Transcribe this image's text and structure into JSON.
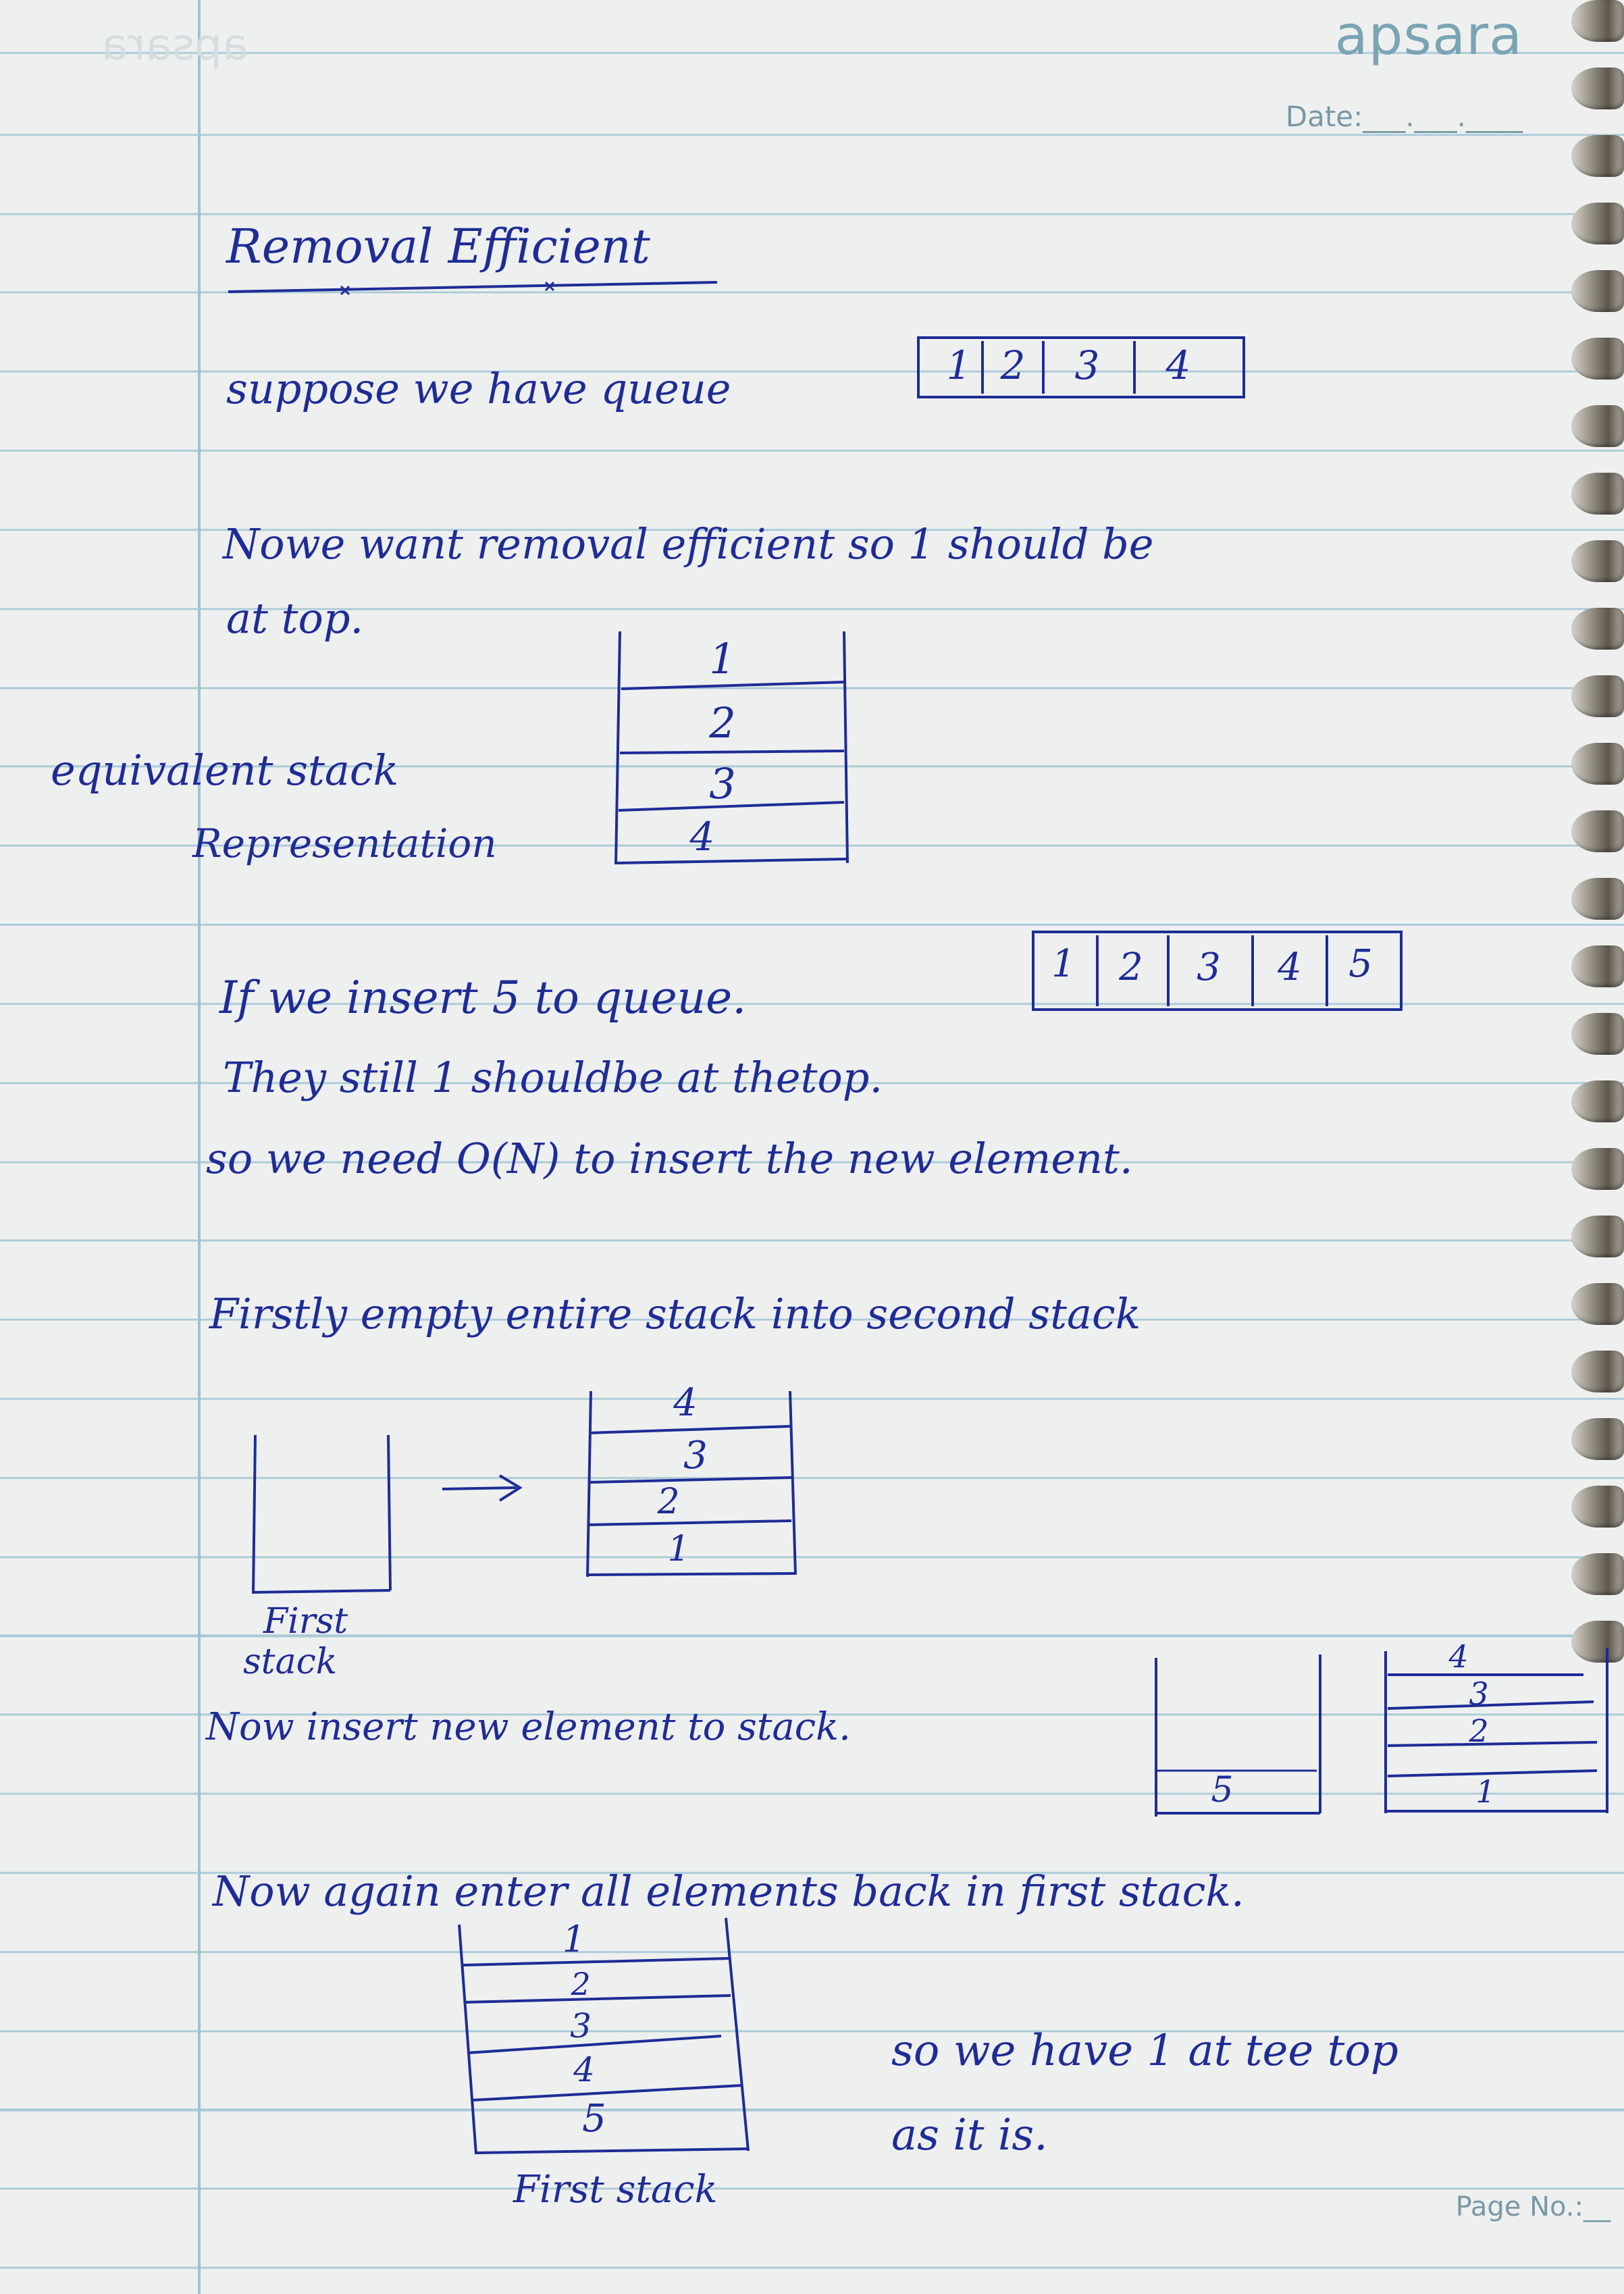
{
  "header": {
    "brand": "apsara",
    "date_label": "Date:___.___.____"
  },
  "footer": {
    "page_label": "Page No.:__"
  },
  "notes": {
    "title": "Removal Efficient",
    "line1": "suppose we have queue",
    "queue1": [
      "1",
      "2",
      "3",
      "4"
    ],
    "line2": "Nowe want removal efficient so 1 should be",
    "line3": "at top.",
    "stack_label_1": "equivalent stack",
    "stack_label_2": "Representation",
    "stack1": [
      "1",
      "2",
      "3",
      "4"
    ],
    "line4": "If we insert 5 to queue.",
    "queue2": [
      "1",
      "2",
      "3",
      "4",
      "5"
    ],
    "line5": "They still 1 shouldbe at thetop.",
    "line6": "so we need O(N) to insert the new element.",
    "line7": "Firstly empty entire stack into second stack",
    "second_stack": [
      "4",
      "3",
      "2",
      "1"
    ],
    "arrow": "→",
    "first_stack_label_1": "First",
    "first_stack_label_2": "stack",
    "line8": "Now insert new element to stack.",
    "insert_first_stack": [
      "5"
    ],
    "insert_second_stack": [
      "4",
      "3",
      "2",
      "1"
    ],
    "line9": "Now again enter all elements back in first stack.",
    "final_stack": [
      "1",
      "2",
      "3",
      "4",
      "5"
    ],
    "final_label": "First stack",
    "line10": "so we have 1 at tee top",
    "line11": "as it is."
  }
}
